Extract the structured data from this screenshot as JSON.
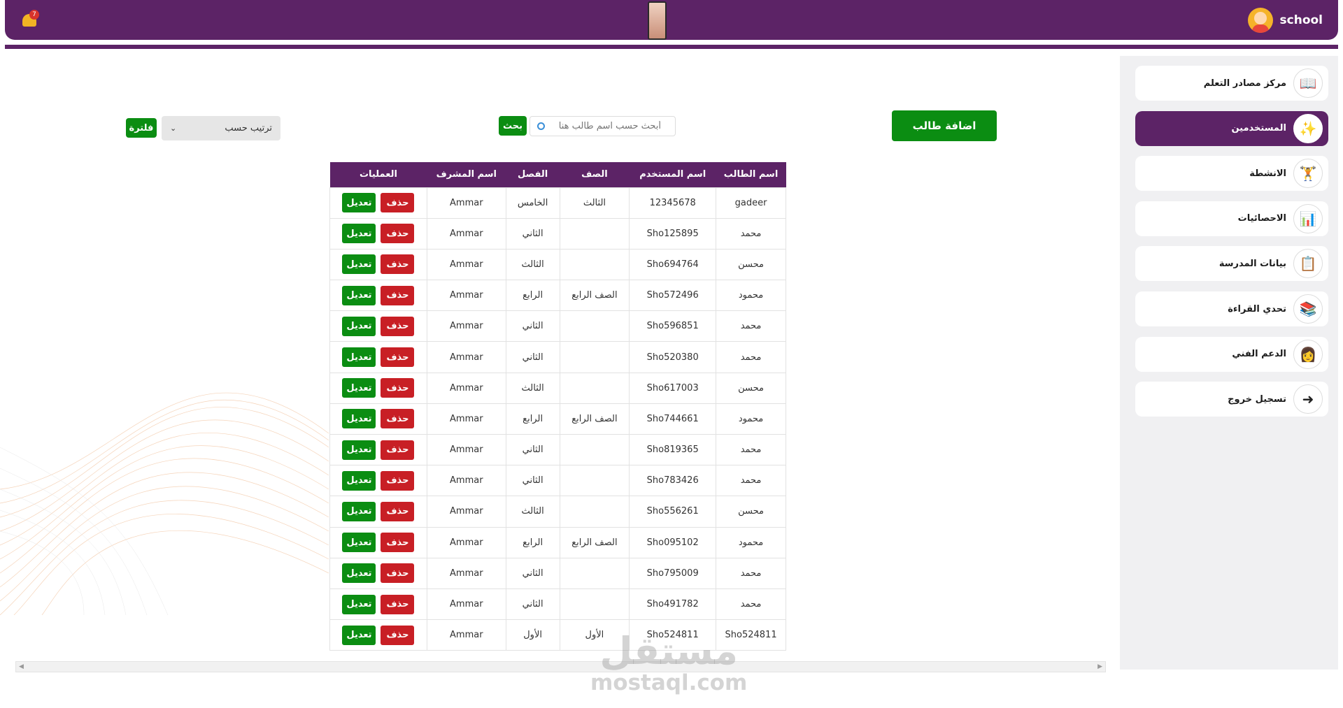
{
  "header": {
    "brand_label": "school",
    "notifications_count": "7"
  },
  "sidebar": {
    "items": [
      {
        "label": "مركز مصادر التعلم",
        "icon": "book-icon",
        "active": false
      },
      {
        "label": "المستخدمين",
        "icon": "users-icon",
        "active": true
      },
      {
        "label": "الانشطة",
        "icon": "activity-icon",
        "active": false
      },
      {
        "label": "الاحصائيات",
        "icon": "chart-icon",
        "active": false
      },
      {
        "label": "بيانات المدرسة",
        "icon": "school-data-icon",
        "active": false
      },
      {
        "label": "تحدي القراءة",
        "icon": "reading-icon",
        "active": false
      },
      {
        "label": "الدعم الفني",
        "icon": "support-icon",
        "active": false
      },
      {
        "label": "تسجيل خروج",
        "icon": "logout-icon",
        "active": false
      }
    ]
  },
  "toolbar": {
    "add_student_label": "اضافة طالب",
    "search_placeholder": "أبحث حسب اسم طالب هنا",
    "search_button": "بحث",
    "sort_label": "ترتيب حسب",
    "filter_button": "فلترة"
  },
  "table": {
    "headers": [
      "اسم الطالب",
      "اسم المستخدم",
      "الصف",
      "الفصل",
      "اسم المشرف",
      "العمليات"
    ],
    "edit_label": "تعديل",
    "delete_label": "حذف",
    "rows": [
      {
        "name": "gadeer",
        "username": "12345678",
        "grade": "الثالث",
        "class": "الخامس",
        "supervisor": "Ammar"
      },
      {
        "name": "محمد",
        "username": "Sho125895",
        "grade": "",
        "class": "الثاني",
        "supervisor": "Ammar"
      },
      {
        "name": "محسن",
        "username": "Sho694764",
        "grade": "",
        "class": "الثالث",
        "supervisor": "Ammar"
      },
      {
        "name": "محمود",
        "username": "Sho572496",
        "grade": "الصف الرابع",
        "class": "الرابع",
        "supervisor": "Ammar"
      },
      {
        "name": "محمد",
        "username": "Sho596851",
        "grade": "",
        "class": "الثاني",
        "supervisor": "Ammar"
      },
      {
        "name": "محمد",
        "username": "Sho520380",
        "grade": "",
        "class": "الثاني",
        "supervisor": "Ammar"
      },
      {
        "name": "محسن",
        "username": "Sho617003",
        "grade": "",
        "class": "الثالث",
        "supervisor": "Ammar"
      },
      {
        "name": "محمود",
        "username": "Sho744661",
        "grade": "الصف الرابع",
        "class": "الرابع",
        "supervisor": "Ammar"
      },
      {
        "name": "محمد",
        "username": "Sho819365",
        "grade": "",
        "class": "الثاني",
        "supervisor": "Ammar"
      },
      {
        "name": "محمد",
        "username": "Sho783426",
        "grade": "",
        "class": "الثاني",
        "supervisor": "Ammar"
      },
      {
        "name": "محسن",
        "username": "Sho556261",
        "grade": "",
        "class": "الثالث",
        "supervisor": "Ammar"
      },
      {
        "name": "محمود",
        "username": "Sho095102",
        "grade": "الصف الرابع",
        "class": "الرابع",
        "supervisor": "Ammar"
      },
      {
        "name": "محمد",
        "username": "Sho795009",
        "grade": "",
        "class": "الثاني",
        "supervisor": "Ammar"
      },
      {
        "name": "محمد",
        "username": "Sho491782",
        "grade": "",
        "class": "الثاني",
        "supervisor": "Ammar"
      },
      {
        "name": "Sho524811",
        "username": "Sho524811",
        "grade": "الأول",
        "class": "الأول",
        "supervisor": "Ammar"
      }
    ]
  },
  "watermark": {
    "main": "مستقل",
    "sub": "mostaql.com"
  },
  "colors": {
    "brand_purple": "#5c2366",
    "action_green": "#0b8d12",
    "delete_red": "#c81f25"
  }
}
